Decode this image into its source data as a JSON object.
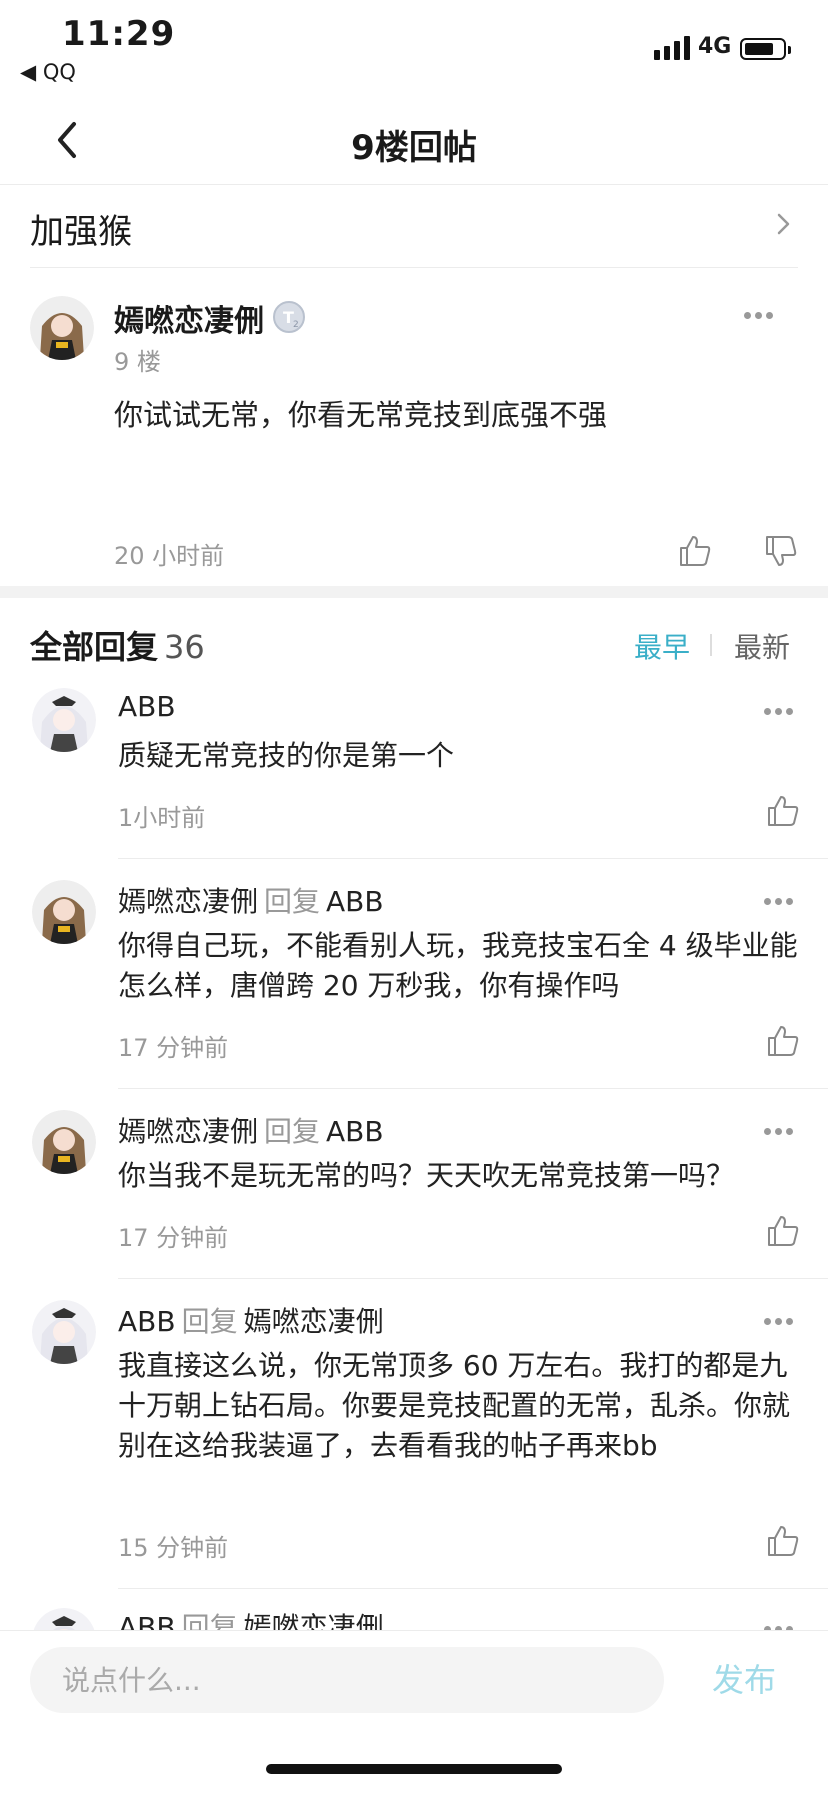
{
  "status_bar": {
    "time": "11:29",
    "back_app": "◀ QQ",
    "network": "4G"
  },
  "nav": {
    "title": "9楼回帖"
  },
  "forum": {
    "name": "加强猴"
  },
  "post": {
    "author": "嫣嘫恋凄侀",
    "floor": "9 楼",
    "body": "你试试无常，你看无常竞技到底强不强",
    "time": "20 小时前"
  },
  "replies_header": {
    "label": "全部回复",
    "count": "36",
    "sort_earliest": "最早",
    "sort_latest": "最新"
  },
  "replies": [
    {
      "user": "ABB",
      "verb": "",
      "target": "",
      "text": "质疑无常竞技的你是第一个",
      "time": "1小时前"
    },
    {
      "user": "嫣嘫恋凄侀",
      "verb": "回复",
      "target": "ABB",
      "text": "你得自己玩，不能看别人玩，我竞技宝石全 4 级毕业能怎么样，唐僧跨 20 万秒我，你有操作吗",
      "time": "17 分钟前"
    },
    {
      "user": "嫣嘫恋凄侀",
      "verb": "回复",
      "target": "ABB",
      "text": "你当我不是玩无常的吗？天天吹无常竞技第一吗？",
      "time": "17 分钟前"
    },
    {
      "user": "ABB",
      "verb": "回复",
      "target": "嫣嘫恋凄侀",
      "text": "我直接这么说，你无常顶多 60 万左右。我打的都是九十万朝上钻石局。你要是竞技配置的无常，乱杀。你就别在这给我装逼了，去看看我的帖子再来bb",
      "time": "15 分钟前"
    },
    {
      "user": "ABB",
      "verb": "回复",
      "target": "嫣嘫恋凄侀",
      "text": "",
      "time": ""
    }
  ],
  "composer": {
    "placeholder": "说点什么...",
    "publish": "发布"
  },
  "colors": {
    "accent": "#3aafc8",
    "publish_disabled": "#9fdae8",
    "muted": "#999999"
  },
  "icons": {
    "back": "chevron-left-icon",
    "forum": "chevron-right-icon",
    "more": "more-icon",
    "like": "thumbs-up-icon",
    "dislike": "thumbs-down-icon"
  }
}
